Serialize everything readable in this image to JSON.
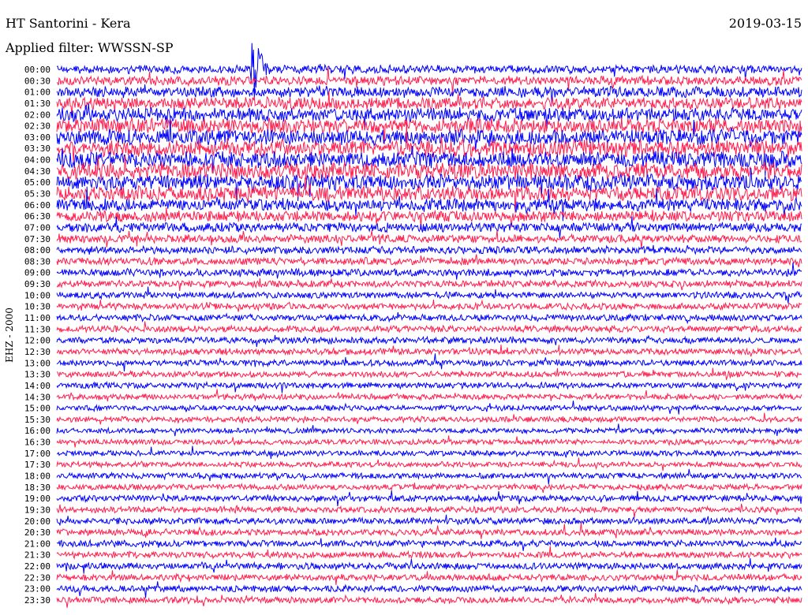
{
  "chart_data": {
    "type": "line",
    "title": "HT Santorini - Kera",
    "date": "2019-03-15",
    "subtitle": "Applied filter: WWSSN-SP",
    "ylabel": "EHZ - 2000",
    "row_labels": [
      "00:00",
      "00:30",
      "01:00",
      "01:30",
      "02:00",
      "02:30",
      "03:00",
      "03:30",
      "04:00",
      "04:30",
      "05:00",
      "05:30",
      "06:00",
      "06:30",
      "07:00",
      "07:30",
      "08:00",
      "08:30",
      "09:00",
      "09:30",
      "10:00",
      "10:30",
      "11:00",
      "11:30",
      "12:00",
      "12:30",
      "13:00",
      "13:30",
      "14:00",
      "14:30",
      "15:00",
      "15:30",
      "16:00",
      "16:30",
      "17:00",
      "17:30",
      "18:00",
      "18:30",
      "19:00",
      "19:30",
      "20:00",
      "20:30",
      "21:00",
      "21:30",
      "22:00",
      "22:30",
      "23:00",
      "23:30"
    ],
    "series_colors": [
      "#0000ff",
      "#ff1f4f"
    ],
    "noise_level": [
      0.45,
      0.5,
      0.6,
      0.65,
      0.75,
      0.85,
      0.85,
      0.9,
      0.9,
      0.9,
      0.85,
      0.8,
      0.7,
      0.6,
      0.5,
      0.45,
      0.42,
      0.4,
      0.4,
      0.38,
      0.36,
      0.36,
      0.36,
      0.36,
      0.35,
      0.35,
      0.34,
      0.33,
      0.32,
      0.32,
      0.3,
      0.3,
      0.3,
      0.3,
      0.3,
      0.3,
      0.32,
      0.32,
      0.34,
      0.34,
      0.36,
      0.36,
      0.36,
      0.36,
      0.36,
      0.36,
      0.36,
      0.36
    ],
    "events": [
      {
        "row": 0,
        "t": 0.26,
        "amp": 6.5
      }
    ]
  }
}
